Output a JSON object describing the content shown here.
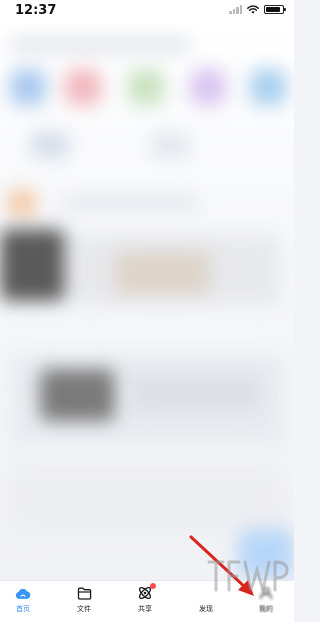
{
  "statusbar": {
    "time": "12:37",
    "icons": [
      "signal-icon",
      "wifi-icon",
      "battery-icon"
    ]
  },
  "content": {
    "blurred": true
  },
  "tabbar": {
    "items": [
      {
        "label": "首页",
        "icon": "cloud-icon",
        "active": true
      },
      {
        "label": "文件",
        "icon": "folder-icon",
        "active": false
      },
      {
        "label": "共享",
        "icon": "orbit-share-icon",
        "active": false,
        "badge": true
      },
      {
        "label": "发现",
        "icon": "discover-icon",
        "active": false
      },
      {
        "label": "我的",
        "icon": "profile-icon",
        "active": false
      }
    ]
  },
  "colors": {
    "accent": "#2f8bf5",
    "badge": "#ff4d4f",
    "arrow": "#d9251c"
  }
}
